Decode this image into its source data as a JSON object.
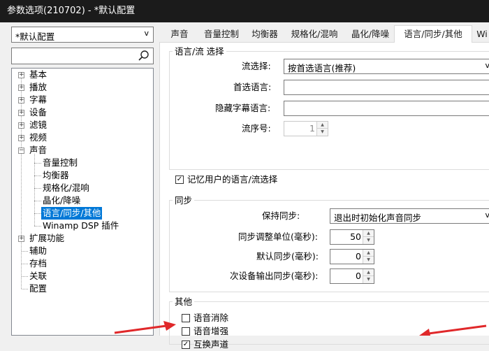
{
  "window": {
    "title": "参数选项(210702) - *默认配置"
  },
  "sidebar": {
    "profile": "*默认配置",
    "search_placeholder": "",
    "tree": [
      {
        "label": "基本",
        "expander": "+"
      },
      {
        "label": "播放",
        "expander": "+"
      },
      {
        "label": "字幕",
        "expander": "+"
      },
      {
        "label": "设备",
        "expander": "+"
      },
      {
        "label": "滤镜",
        "expander": "+"
      },
      {
        "label": "视频",
        "expander": "+"
      },
      {
        "label": "声音",
        "expander": "−"
      },
      {
        "label": "音量控制",
        "child": true
      },
      {
        "label": "均衡器",
        "child": true
      },
      {
        "label": "规格化/混响",
        "child": true
      },
      {
        "label": "晶化/降噪",
        "child": true
      },
      {
        "label": "语言/同步/其他",
        "child": true,
        "selected": true
      },
      {
        "label": "Winamp DSP 插件",
        "child": true
      },
      {
        "label": "扩展功能",
        "expander": "+"
      },
      {
        "label": "辅助"
      },
      {
        "label": "存档"
      },
      {
        "label": "关联"
      },
      {
        "label": "配置"
      }
    ]
  },
  "tabs": [
    "声音",
    "音量控制",
    "均衡器",
    "规格化/混响",
    "晶化/降噪",
    "语言/同步/其他",
    "Wi"
  ],
  "active_tab": 5,
  "lang_group": {
    "title": "语言/流 选择",
    "stream_label": "流选择:",
    "stream_value": "按首选语言(推荐)",
    "pref_lang_label": "首选语言:",
    "pref_lang_value": "",
    "hidden_sub_label": "隐藏字幕语言:",
    "hidden_sub_value": "",
    "stream_no_label": "流序号:",
    "stream_no_value": "1"
  },
  "remember_lang": {
    "label": "记忆用户的语言/流选择",
    "checked": true
  },
  "sync_group": {
    "title": "同步",
    "keep_sync_label": "保持同步:",
    "keep_sync_value": "退出时初始化声音同步",
    "adjust_unit_label": "同步调整单位(毫秒):",
    "adjust_unit_value": "50",
    "default_sync_label": "默认同步(毫秒):",
    "default_sync_value": "0",
    "secondary_sync_label": "次设备输出同步(毫秒):",
    "secondary_sync_value": "0"
  },
  "other_group": {
    "title": "其他",
    "voice_cancel": {
      "label": "语音消除",
      "checked": false
    },
    "voice_enhance": {
      "label": "语音增强",
      "checked": false
    },
    "swap_channels": {
      "label": "互换声道",
      "checked": true
    }
  },
  "annotation_color": "#e0282a"
}
